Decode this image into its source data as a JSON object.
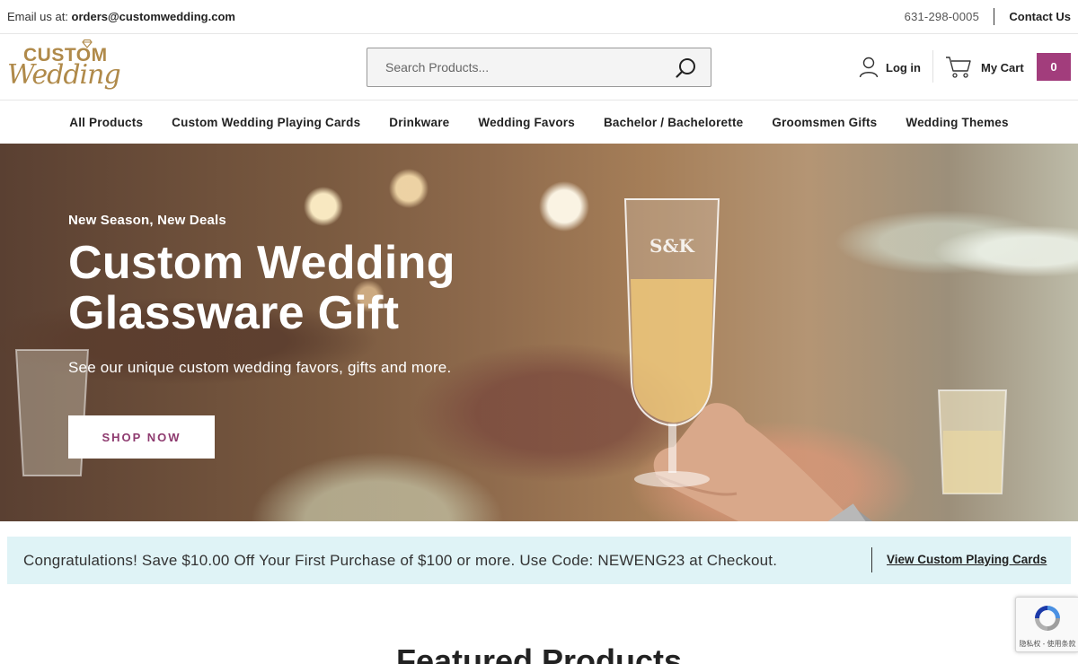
{
  "topbar": {
    "email_label": "Email us at: ",
    "email": "orders@customwedding.com",
    "phone": "631-298-0005",
    "contact_label": "Contact Us"
  },
  "header": {
    "logo_line1": "CUSTOM",
    "logo_line2": "Wedding",
    "search_placeholder": "Search Products...",
    "login_label": "Log in",
    "cart_label": "My Cart",
    "cart_count": "0"
  },
  "nav": {
    "items": [
      "All Products",
      "Custom Wedding Playing Cards",
      "Drinkware",
      "Wedding Favors",
      "Bachelor / Bachelorette",
      "Groomsmen Gifts",
      "Wedding Themes"
    ]
  },
  "hero": {
    "kicker": "New Season, New Deals",
    "title": "Custom Wedding Glassware Gift",
    "subtitle": "See our unique custom wedding favors, gifts and more.",
    "cta_label": "SHOP NOW",
    "glass_engraving": "S&K"
  },
  "promo": {
    "message": "Congratulations! Save $10.00 Off Your First Purchase of $100 or more. Use Code: NEWENG23 at Checkout.",
    "link_label": "View Custom Playing Cards"
  },
  "featured": {
    "heading": "Featured Products"
  },
  "recaptcha": {
    "text": "隐私权 - 使用条款"
  },
  "colors": {
    "brand_gold": "#b08a4a",
    "accent_purple": "#a23d7c",
    "promo_bg": "#dff3f6"
  }
}
